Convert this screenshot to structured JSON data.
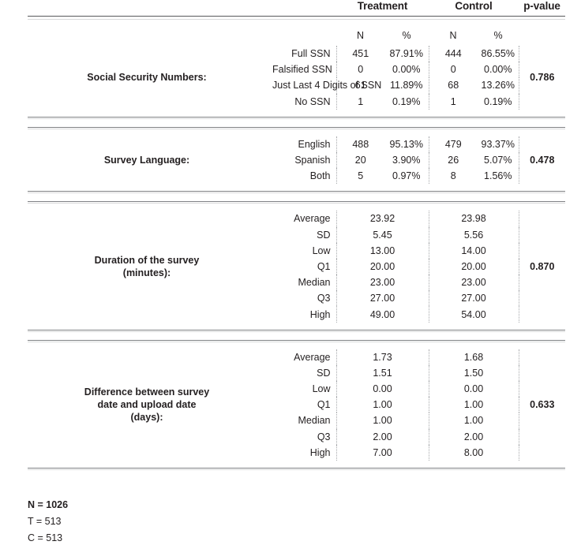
{
  "header": {
    "group_labels": [
      "Treatment",
      "Control"
    ],
    "pvalue_label": "p-value",
    "sub_labels": {
      "n": "N",
      "pct": "%"
    }
  },
  "sections": [
    {
      "label": "Social Security Numbers:",
      "kind": "categorical",
      "pvalue": "0.786",
      "rows": [
        {
          "name": "Full SSN",
          "t_n": "451",
          "t_pct": "87.91%",
          "c_n": "444",
          "c_pct": "86.55%"
        },
        {
          "name": "Falsified SSN",
          "t_n": "0",
          "t_pct": "0.00%",
          "c_n": "0",
          "c_pct": "0.00%"
        },
        {
          "name": "Just Last 4 Digits of SSN",
          "t_n": "61",
          "t_pct": "11.89%",
          "c_n": "68",
          "c_pct": "13.26%"
        },
        {
          "name": "No SSN",
          "t_n": "1",
          "t_pct": "0.19%",
          "c_n": "1",
          "c_pct": "0.19%"
        }
      ]
    },
    {
      "label": "Survey Language:",
      "kind": "categorical",
      "pvalue": "0.478",
      "rows": [
        {
          "name": "English",
          "t_n": "488",
          "t_pct": "95.13%",
          "c_n": "479",
          "c_pct": "93.37%"
        },
        {
          "name": "Spanish",
          "t_n": "20",
          "t_pct": "3.90%",
          "c_n": "26",
          "c_pct": "5.07%"
        },
        {
          "name": "Both",
          "t_n": "5",
          "t_pct": "0.97%",
          "c_n": "8",
          "c_pct": "1.56%"
        }
      ]
    },
    {
      "label": "Duration of the survey\n(minutes):",
      "label_line1": "Duration of the survey",
      "label_line2": "(minutes):",
      "kind": "numeric",
      "pvalue": "0.870",
      "rows": [
        {
          "name": "Average",
          "t": "23.92",
          "c": "23.98"
        },
        {
          "name": "SD",
          "t": "5.45",
          "c": "5.56"
        },
        {
          "name": "Low",
          "t": "13.00",
          "c": "14.00"
        },
        {
          "name": "Q1",
          "t": "20.00",
          "c": "20.00"
        },
        {
          "name": "Median",
          "t": "23.00",
          "c": "23.00"
        },
        {
          "name": "Q3",
          "t": "27.00",
          "c": "27.00"
        },
        {
          "name": "High",
          "t": "49.00",
          "c": "54.00"
        }
      ]
    },
    {
      "label": "Difference between survey date and upload date (days):",
      "label_line1": "Difference between survey",
      "label_line2": "date and upload date",
      "label_line3": "(days):",
      "kind": "numeric",
      "pvalue": "0.633",
      "rows": [
        {
          "name": "Average",
          "t": "1.73",
          "c": "1.68"
        },
        {
          "name": "SD",
          "t": "1.51",
          "c": "1.50"
        },
        {
          "name": "Low",
          "t": "0.00",
          "c": "0.00"
        },
        {
          "name": "Q1",
          "t": "1.00",
          "c": "1.00"
        },
        {
          "name": "Median",
          "t": "1.00",
          "c": "1.00"
        },
        {
          "name": "Q3",
          "t": "2.00",
          "c": "2.00"
        },
        {
          "name": "High",
          "t": "7.00",
          "c": "8.00"
        }
      ]
    }
  ],
  "footer": {
    "total": "N = 1026",
    "treatment": "T = 513",
    "control": "C = 513"
  },
  "colors": {
    "text": "#231f20",
    "rule": "#58595b",
    "separator": "#808285",
    "divider": "#a7a9ac"
  }
}
